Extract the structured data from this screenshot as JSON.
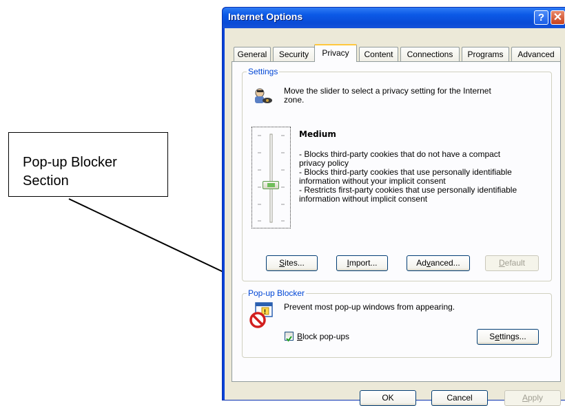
{
  "annotation": {
    "text_line1": "Pop-up Blocker",
    "text_line2": "Section"
  },
  "window": {
    "title": "Internet Options",
    "help_glyph": "?",
    "close_glyph": "✕"
  },
  "tabs": [
    {
      "label": "General"
    },
    {
      "label": "Security"
    },
    {
      "label": "Privacy",
      "active": true
    },
    {
      "label": "Content"
    },
    {
      "label": "Connections"
    },
    {
      "label": "Programs"
    },
    {
      "label": "Advanced"
    }
  ],
  "settings": {
    "group_label": "Settings",
    "intro_line1": "Move the slider to select a privacy setting for the Internet",
    "intro_line2": "zone.",
    "level": "Medium",
    "slider_position": "Medium",
    "desc_lines": [
      "- Blocks third-party cookies that do not have a compact",
      "privacy policy",
      "- Blocks third-party cookies that use personally identifiable",
      "information without your implicit consent",
      "- Restricts first-party cookies that use personally identifiable",
      "information without implicit consent"
    ],
    "buttons": {
      "sites": {
        "pre": "",
        "mn": "S",
        "post": "ites..."
      },
      "import": {
        "pre": "",
        "mn": "I",
        "post": "mport..."
      },
      "advanced": {
        "pre": "Ad",
        "mn": "v",
        "post": "anced..."
      },
      "default": {
        "pre": "",
        "mn": "D",
        "post": "efault"
      }
    }
  },
  "popup_blocker": {
    "group_label": "Pop-up Blocker",
    "description": "Prevent most pop-up windows from appearing.",
    "checkbox": {
      "pre": "",
      "mn": "B",
      "post": "lock pop-ups",
      "checked": true
    },
    "settings_button": {
      "pre": "S",
      "mn": "e",
      "post": "ttings..."
    }
  },
  "footer": {
    "ok": "OK",
    "cancel": "Cancel",
    "apply": {
      "pre": "",
      "mn": "A",
      "post": "pply"
    }
  },
  "colors": {
    "title_bar": "#0b59e6",
    "group_label": "#0046d5",
    "active_tab_accent": "#ffc73c"
  }
}
